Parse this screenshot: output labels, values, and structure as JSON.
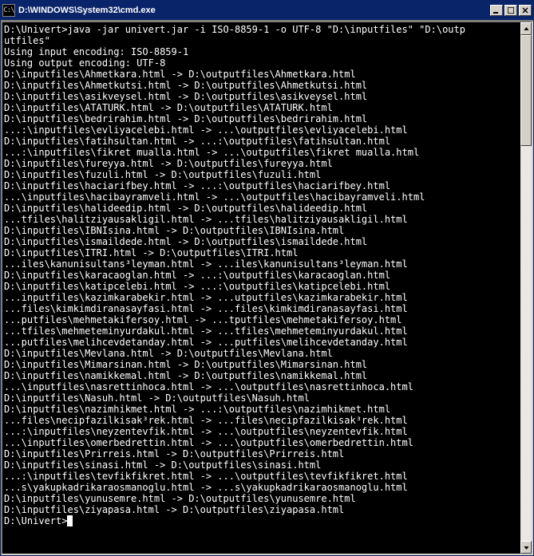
{
  "window": {
    "icon_text": "C:\\",
    "title": "D:\\WINDOWS\\System32\\cmd.exe"
  },
  "buttons": {
    "minimize": "minimize",
    "maximize": "maximize",
    "close": "close"
  },
  "scrollbar": {
    "up": "scroll-up",
    "down": "scroll-down",
    "thumb_top_pct": 0,
    "thumb_height_pct": 22
  },
  "terminal": {
    "lines": [
      "",
      "D:\\Univert>java -jar univert.jar -i ISO-8859-1 -o UTF-8 \"D:\\inputfiles\" \"D:\\outp",
      "utfiles\"",
      "Using input encoding: ISO-8859-1",
      "Using output encoding: UTF-8",
      "D:\\inputfiles\\Ahmetkara.html -> D:\\outputfiles\\Ahmetkara.html",
      "D:\\inputfiles\\Ahmetkutsi.html -> D:\\outputfiles\\Ahmetkutsi.html",
      "D:\\inputfiles\\asikveysel.html -> D:\\outputfiles\\asikveysel.html",
      "D:\\inputfiles\\ATATURK.html -> D:\\outputfiles\\ATATURK.html",
      "D:\\inputfiles\\bedrirahim.html -> D:\\outputfiles\\bedrirahim.html",
      "...:\\inputfiles\\evliyacelebi.html -> ...\\outputfiles\\evliyacelebi.html",
      "D:\\inputfiles\\fatihsultan.html -> ...:\\outputfiles\\fatihsultan.html",
      "...:\\inputfiles\\fikret mualla.html -> ...\\outputfiles\\fikret mualla.html",
      "D:\\inputfiles\\fureyya.html -> D:\\outputfiles\\fureyya.html",
      "D:\\inputfiles\\fuzuli.html -> D:\\outputfiles\\fuzuli.html",
      "D:\\inputfiles\\haciarifbey.html -> ...:\\outputfiles\\haciarifbey.html",
      "...\\inputfiles\\hacibayramveli.html -> ...\\outputfiles\\hacibayramveli.html",
      "D:\\inputfiles\\halideedip.html -> D:\\outputfiles\\halideedip.html",
      "...tfiles\\halitziyausakligil.html -> ...tfiles\\halitziyausakligil.html",
      "D:\\inputfiles\\IBNIsina.html -> D:\\outputfiles\\IBNIsina.html",
      "D:\\inputfiles\\ismaildede.html -> D:\\outputfiles\\ismaildede.html",
      "D:\\inputfiles\\ITRI.html -> D:\\outputfiles\\ITRI.html",
      "...iles\\kanunisultans³leyman.html -> ...iles\\kanunisultans³leyman.html",
      "D:\\inputfiles\\karacaoglan.html -> ...:\\outputfiles\\karacaoglan.html",
      "D:\\inputfiles\\katipcelebi.html -> ...:\\outputfiles\\katipcelebi.html",
      "...inputfiles\\kazimkarabekir.html -> ...utputfiles\\kazimkarabekir.html",
      "...files\\kimkimdiranasayfasi.html -> ...files\\kimkimdiranasayfasi.html",
      "...putfiles\\mehmetakifersoy.html -> ...tputfiles\\mehmetakifersoy.html",
      "...tfiles\\mehmeteminyurdakul.html -> ...tfiles\\mehmeteminyurdakul.html",
      "...putfiles\\melihcevdetanday.html -> ...putfiles\\melihcevdetanday.html",
      "D:\\inputfiles\\Mevlana.html -> D:\\outputfiles\\Mevlana.html",
      "D:\\inputfiles\\Mimarsinan.html -> D:\\outputfiles\\Mimarsinan.html",
      "D:\\inputfiles\\namikkemal.html -> D:\\outputfiles\\namikkemal.html",
      "...\\inputfiles\\nasrettinhoca.html -> ...\\outputfiles\\nasrettinhoca.html",
      "D:\\inputfiles\\Nasuh.html -> D:\\outputfiles\\Nasuh.html",
      "D:\\inputfiles\\nazimhikmet.html -> ...:\\outputfiles\\nazimhikmet.html",
      "...files\\necipfazilkisak³rek.html -> ...files\\necipfazilkisak³rek.html",
      "...:\\inputfiles\\neyzentevfik.html -> ...\\outputfiles\\neyzentevfik.html",
      "...\\inputfiles\\omerbedrettin.html -> ...\\outputfiles\\omerbedrettin.html",
      "D:\\inputfiles\\Prirreis.html -> D:\\outputfiles\\Prirreis.html",
      "D:\\inputfiles\\sinasi.html -> D:\\outputfiles\\sinasi.html",
      "...:\\inputfiles\\tevfikfikret.html -> ...\\outputfiles\\tevfikfikret.html",
      "...s\\yakupkadrikaraosmanoglu.html -> ...s\\yakupkadrikaraosmanoglu.html",
      "D:\\inputfiles\\yunusemre.html -> D:\\outputfiles\\yunusemre.html",
      "D:\\inputfiles\\ziyapasa.html -> D:\\outputfiles\\ziyapasa.html",
      "",
      "D:\\Univert>"
    ]
  }
}
